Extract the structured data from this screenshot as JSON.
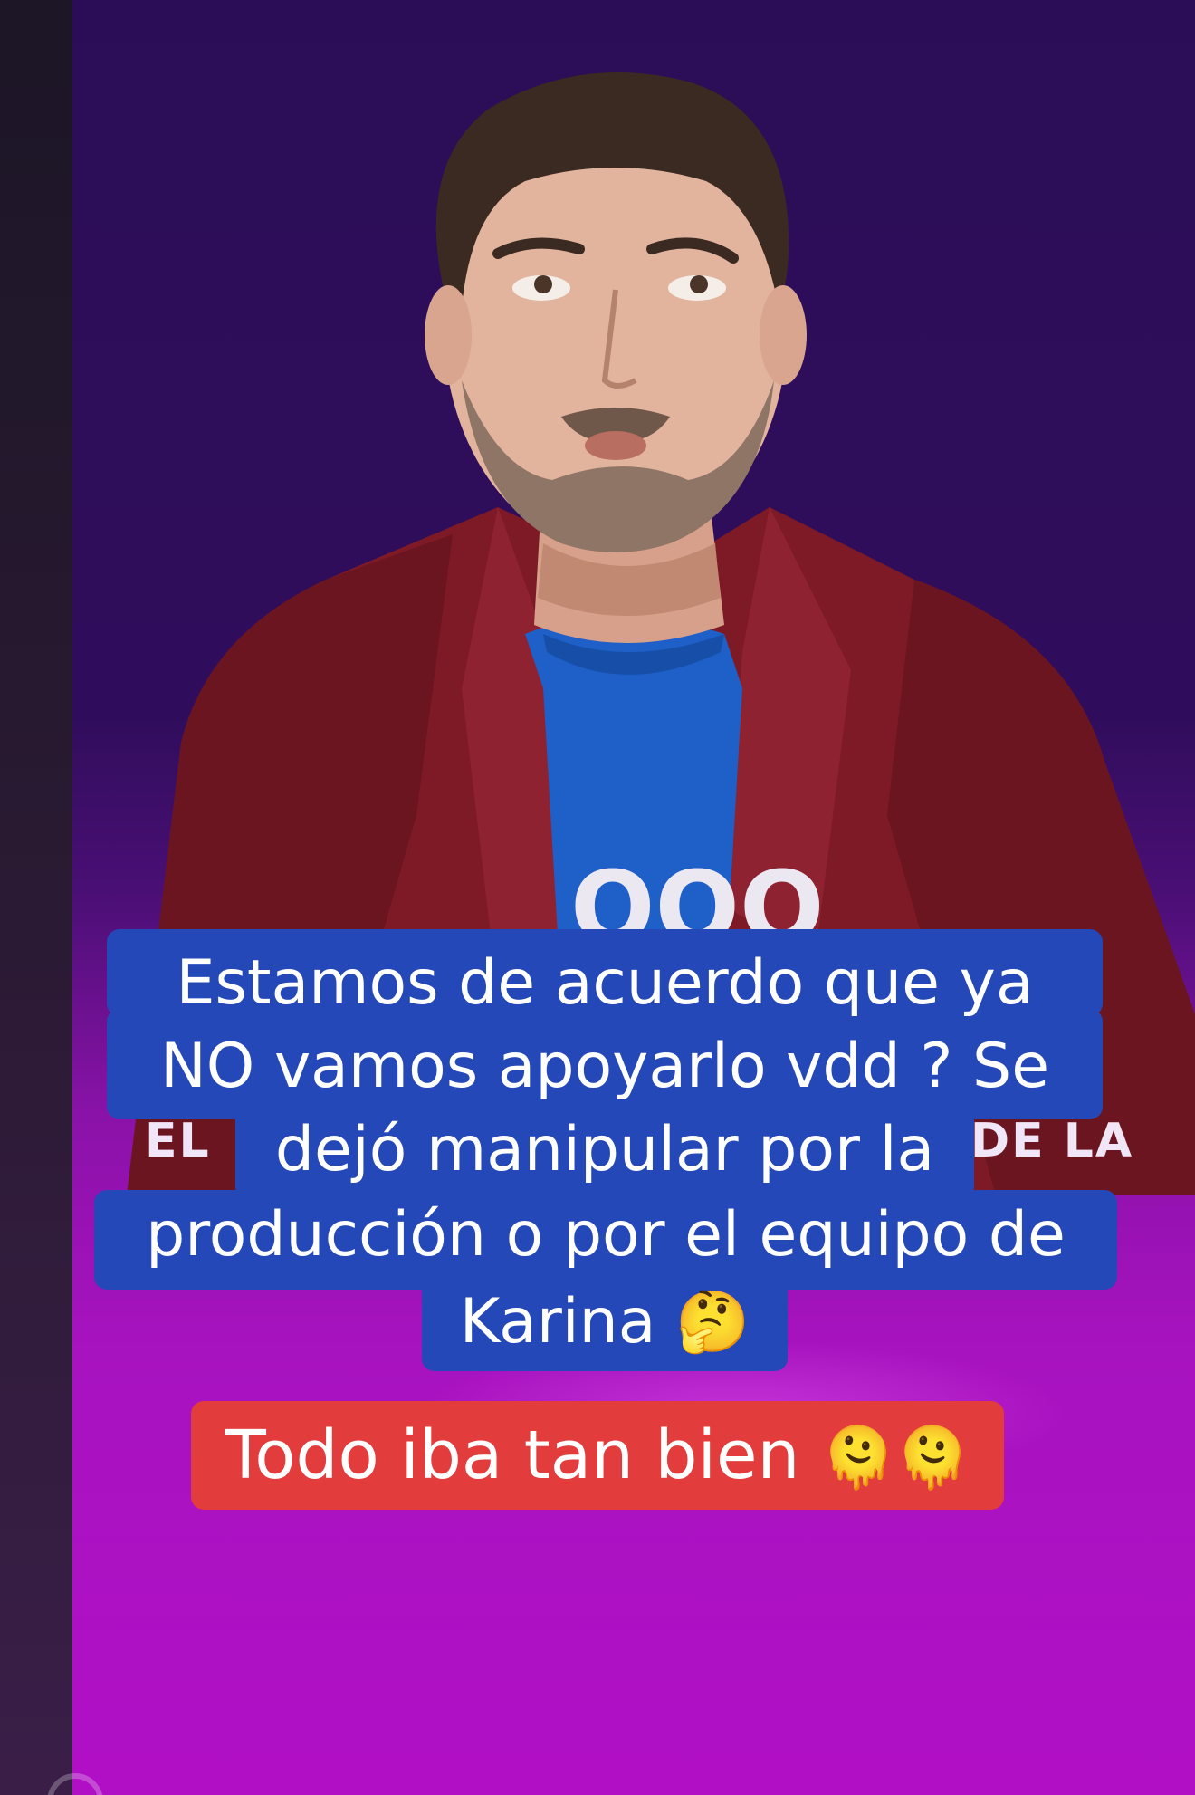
{
  "video": {
    "background_logo_left": "EL",
    "background_logo_right": "DE LA",
    "shirt_text": "OOO"
  },
  "caption": {
    "lines": [
      "Estamos de acuerdo que ya",
      "NO vamos apoyarlo vdd ? Se",
      "dejó manipular por la",
      "producción o por el equipo de",
      "Karina"
    ],
    "thinking_emoji": "🤔",
    "box_color": "#2448b8"
  },
  "caption2": {
    "text": "Todo iba tan bien",
    "emoji": "🫠🫠",
    "box_color": "#e23c3c"
  },
  "colors": {
    "background_top": "#2b0d57",
    "background_bottom": "#b10fc6",
    "jacket": "#7d1a26",
    "shirt": "#1e5fc8"
  }
}
